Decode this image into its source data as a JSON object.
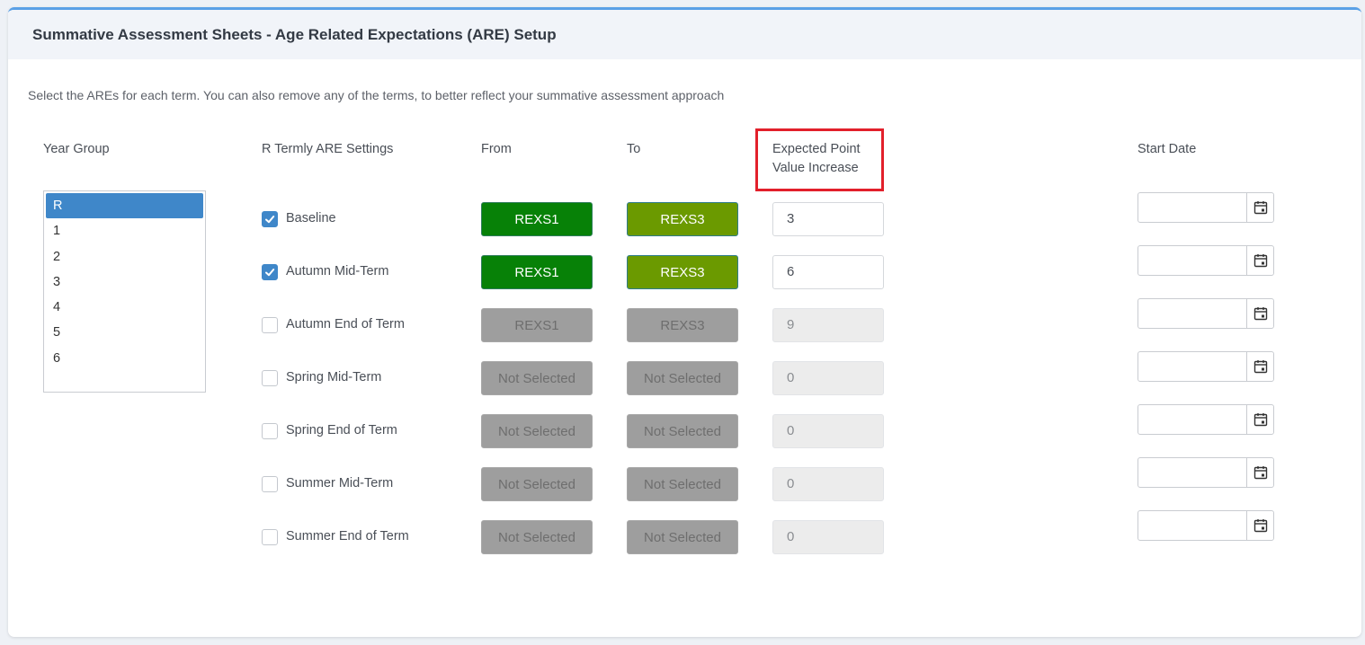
{
  "header": {
    "title": "Summative Assessment Sheets - Age Related Expectations (ARE) Setup"
  },
  "intro": "Select the AREs for each term. You can also remove any of the terms, to better reflect your summative assessment approach",
  "columns": {
    "year_group": "Year Group",
    "settings": "R Termly ARE Settings",
    "from": "From",
    "to": "To",
    "expected_line1": "Expected Point",
    "expected_line2": "Value Increase",
    "start_date": "Start Date"
  },
  "year_groups": [
    "R",
    "1",
    "2",
    "3",
    "4",
    "5",
    "6"
  ],
  "selected_year": "R",
  "terms": [
    {
      "label": "Baseline",
      "checked": true,
      "from": "REXS1",
      "to": "REXS3",
      "value": "3"
    },
    {
      "label": "Autumn Mid-Term",
      "checked": true,
      "from": "REXS1",
      "to": "REXS3",
      "value": "6"
    },
    {
      "label": "Autumn End of Term",
      "checked": false,
      "from": "REXS1",
      "to": "REXS3",
      "value": "9"
    },
    {
      "label": "Spring Mid-Term",
      "checked": false,
      "from": "Not Selected",
      "to": "Not Selected",
      "value": "0"
    },
    {
      "label": "Spring End of Term",
      "checked": false,
      "from": "Not Selected",
      "to": "Not Selected",
      "value": "0"
    },
    {
      "label": "Summer Mid-Term",
      "checked": false,
      "from": "Not Selected",
      "to": "Not Selected",
      "value": "0"
    },
    {
      "label": "Summer End of Term",
      "checked": false,
      "from": "Not Selected",
      "to": "Not Selected",
      "value": "0"
    }
  ],
  "colors": {
    "accent": "#3f87c9",
    "from_active": "#078107",
    "to_active": "#6b9a00",
    "disabled": "#9e9e9e",
    "highlight": "#e2202b"
  }
}
